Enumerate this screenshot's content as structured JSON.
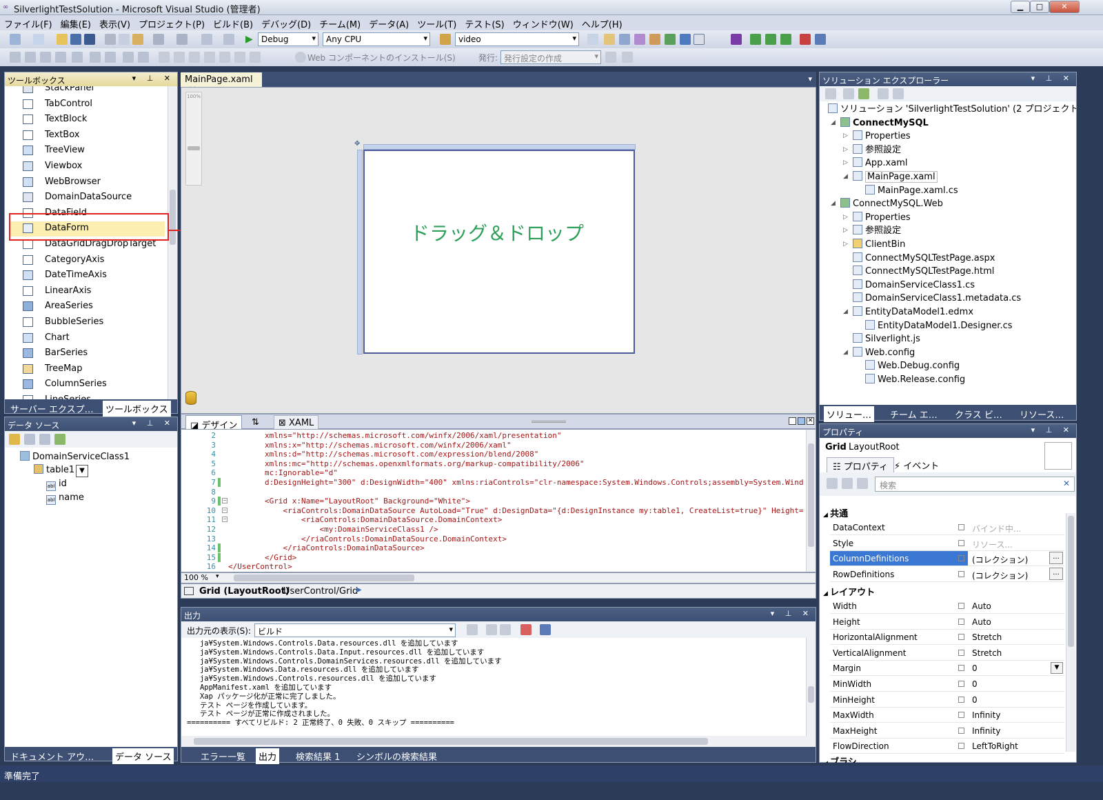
{
  "window": {
    "title": "SilverlightTestSolution - Microsoft Visual Studio (管理者)",
    "min": "▁",
    "max": "□",
    "close": "✕"
  },
  "menu": [
    "ファイル(F)",
    "編集(E)",
    "表示(V)",
    "プロジェクト(P)",
    "ビルド(B)",
    "デバッグ(D)",
    "チーム(M)",
    "データ(A)",
    "ツール(T)",
    "テスト(S)",
    "ウィンドウ(W)",
    "ヘルプ(H)"
  ],
  "toolbar": {
    "config": "Debug",
    "platform": "Any CPU",
    "search": "video",
    "install": "Web コンポーネントのインストール(S)",
    "publish_label": "発行:",
    "publish": "発行設定の作成"
  },
  "toolbox": {
    "title": "ツールボックス",
    "items": [
      "StackPanel",
      "TabControl",
      "TextBlock",
      "TextBox",
      "TreeView",
      "Viewbox",
      "WebBrowser",
      "DomainDataSource",
      "DataField",
      "DataForm",
      "DataGridDragDropTarget",
      "CategoryAxis",
      "DateTimeAxis",
      "LinearAxis",
      "AreaSeries",
      "BubbleSeries",
      "Chart",
      "BarSeries",
      "TreeMap",
      "ColumnSeries",
      "LineSeries"
    ],
    "tabs": [
      "サーバー エクスプ…",
      "ツールボックス"
    ]
  },
  "annotation": "ドラッグ＆ドロップ",
  "datasource": {
    "title": "データ ソース",
    "root": "DomainServiceClass1",
    "table": "table1",
    "fields": [
      "id",
      "name"
    ],
    "tabs": [
      "ドキュメント アウ…",
      "データ ソース"
    ]
  },
  "editor": {
    "tab": "MainPage.xaml",
    "zoom": "100%",
    "design_tab": "デザイン",
    "swap": "⇅",
    "xaml_tab": "XAML",
    "zoom_pct": "100 %",
    "lines": [
      {
        "n": "2",
        "t": "        xmlns=\"http://schemas.microsoft.com/winfx/2006/xaml/presentation\""
      },
      {
        "n": "3",
        "t": "        xmlns:x=\"http://schemas.microsoft.com/winfx/2006/xaml\""
      },
      {
        "n": "4",
        "t": "        xmlns:d=\"http://schemas.microsoft.com/expression/blend/2008\""
      },
      {
        "n": "5",
        "t": "        xmlns:mc=\"http://schemas.openxmlformats.org/markup-compatibility/2006\""
      },
      {
        "n": "6",
        "t": "        mc:Ignorable=\"d\""
      },
      {
        "n": "7",
        "t": "        d:DesignHeight=\"300\" d:DesignWidth=\"400\" xmlns:riaControls=\"clr-namespace:System.Windows.Controls;assembly=System.Wind"
      },
      {
        "n": "8",
        "t": ""
      },
      {
        "n": "9",
        "t": "        <Grid x:Name=\"LayoutRoot\" Background=\"White\">"
      },
      {
        "n": "10",
        "t": "            <riaControls:DomainDataSource AutoLoad=\"True\" d:DesignData=\"{d:DesignInstance my:table1, CreateList=true}\" Height="
      },
      {
        "n": "11",
        "t": "                <riaControls:DomainDataSource.DomainContext>"
      },
      {
        "n": "12",
        "t": "                    <my:DomainServiceClass1 />"
      },
      {
        "n": "13",
        "t": "                </riaControls:DomainDataSource.DomainContext>"
      },
      {
        "n": "14",
        "t": "            </riaControls:DomainDataSource>"
      },
      {
        "n": "15",
        "t": "        </Grid>"
      },
      {
        "n": "16",
        "t": "</UserControl>"
      }
    ],
    "status_bold": "Grid (LayoutRoot)",
    "status_path": "UserControl/Grid"
  },
  "output": {
    "title": "出力",
    "source_label": "出力元の表示(S):",
    "source": "ビルド",
    "lines": [
      "   ja¥System.Windows.Controls.Data.resources.dll を追加しています",
      "   ja¥System.Windows.Controls.Data.Input.resources.dll を追加しています",
      "   ja¥System.Windows.Controls.DomainServices.resources.dll を追加しています",
      "   ja¥System.Windows.Data.resources.dll を追加しています",
      "   ja¥System.Windows.Controls.resources.dll を追加しています",
      "   AppManifest.xaml を追加しています",
      "   Xap パッケージ化が正常に完了しました。",
      "   テスト ページを作成しています。",
      "   テスト ページが正常に作成されました。",
      "========== すべてリビルド: 2 正常終了、0 失敗、0 スキップ =========="
    ],
    "tabs": [
      "エラー一覧",
      "出力",
      "検索結果 1",
      "シンボルの検索結果"
    ]
  },
  "solution": {
    "title": "ソリューション エクスプローラー",
    "items": [
      {
        "t": "ソリューション 'SilverlightTestSolution' (2 プロジェクト)",
        "lvl": 0,
        "exp": ""
      },
      {
        "t": "ConnectMySQL",
        "lvl": 1,
        "exp": "◢",
        "bold": true
      },
      {
        "t": "Properties",
        "lvl": 2,
        "exp": "▷"
      },
      {
        "t": "参照設定",
        "lvl": 2,
        "exp": "▷"
      },
      {
        "t": "App.xaml",
        "lvl": 2,
        "exp": "▷"
      },
      {
        "t": "MainPage.xaml",
        "lvl": 2,
        "exp": "◢"
      },
      {
        "t": "MainPage.xaml.cs",
        "lvl": 3,
        "exp": ""
      },
      {
        "t": "ConnectMySQL.Web",
        "lvl": 1,
        "exp": "◢"
      },
      {
        "t": "Properties",
        "lvl": 2,
        "exp": "▷"
      },
      {
        "t": "参照設定",
        "lvl": 2,
        "exp": "▷"
      },
      {
        "t": "ClientBin",
        "lvl": 2,
        "exp": "▷"
      },
      {
        "t": "ConnectMySQLTestPage.aspx",
        "lvl": 2,
        "exp": ""
      },
      {
        "t": "ConnectMySQLTestPage.html",
        "lvl": 2,
        "exp": ""
      },
      {
        "t": "DomainServiceClass1.cs",
        "lvl": 2,
        "exp": ""
      },
      {
        "t": "DomainServiceClass1.metadata.cs",
        "lvl": 2,
        "exp": ""
      },
      {
        "t": "EntityDataModel1.edmx",
        "lvl": 2,
        "exp": "◢"
      },
      {
        "t": "EntityDataModel1.Designer.cs",
        "lvl": 3,
        "exp": ""
      },
      {
        "t": "Silverlight.js",
        "lvl": 2,
        "exp": ""
      },
      {
        "t": "Web.config",
        "lvl": 2,
        "exp": "◢"
      },
      {
        "t": "Web.Debug.config",
        "lvl": 3,
        "exp": ""
      },
      {
        "t": "Web.Release.config",
        "lvl": 3,
        "exp": ""
      }
    ],
    "tabs": [
      "ソリュー…",
      "チーム エ…",
      "クラス ビ…",
      "リソース…"
    ]
  },
  "properties": {
    "title": "プロパティ",
    "type": "Grid",
    "name": "LayoutRoot",
    "tab_props": "プロパティ",
    "tab_events": "イベント",
    "search": "検索",
    "cat_common": "共通",
    "cat_layout": "レイアウト",
    "cat_brush": "ブラシ",
    "common": [
      {
        "n": "DataContext",
        "v": "バインド中..."
      },
      {
        "n": "Style",
        "v": "リソース..."
      },
      {
        "n": "ColumnDefinitions",
        "v": "(コレクション)"
      },
      {
        "n": "RowDefinitions",
        "v": "(コレクション)"
      }
    ],
    "layout": [
      {
        "n": "Width",
        "v": "Auto"
      },
      {
        "n": "Height",
        "v": "Auto"
      },
      {
        "n": "HorizontalAlignment",
        "v": "Stretch"
      },
      {
        "n": "VerticalAlignment",
        "v": "Stretch"
      },
      {
        "n": "Margin",
        "v": "0"
      },
      {
        "n": "MinWidth",
        "v": "0"
      },
      {
        "n": "MinHeight",
        "v": "0"
      },
      {
        "n": "MaxWidth",
        "v": "Infinity"
      },
      {
        "n": "MaxHeight",
        "v": "Infinity"
      },
      {
        "n": "FlowDirection",
        "v": "LeftToRight"
      }
    ]
  },
  "status": "準備完了"
}
